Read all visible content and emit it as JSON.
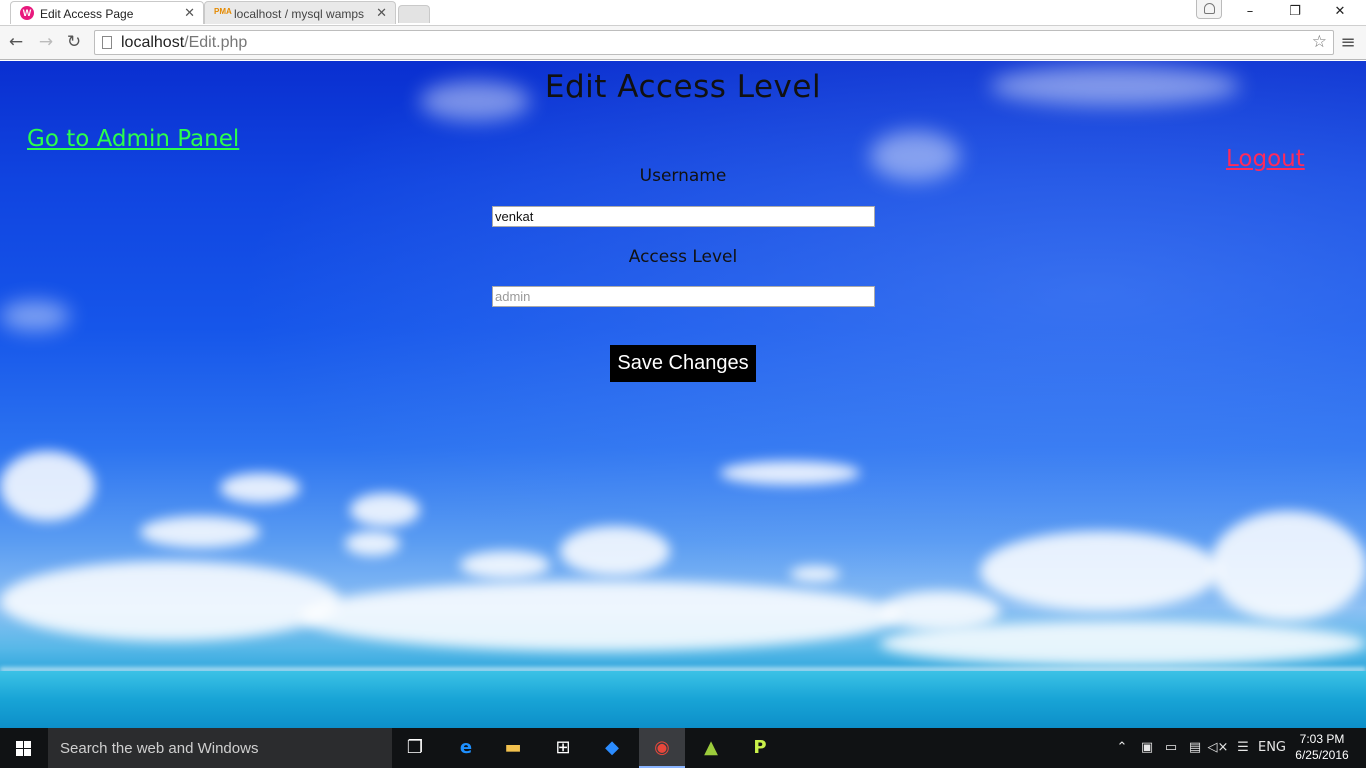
{
  "browser": {
    "tabs": [
      {
        "title": "Edit Access Page",
        "active": true,
        "favicon": "W"
      },
      {
        "title": "localhost / mysql wampse",
        "active": false,
        "favicon": "PMA"
      }
    ],
    "url_host": "localhost",
    "url_path": "/Edit.php",
    "window_controls": {
      "minimize": "–",
      "restore": "❐",
      "close": "✕"
    }
  },
  "page": {
    "heading": "Edit Access Level",
    "admin_link": "Go to Admin Panel",
    "logout_link": "Logout",
    "username_label": "Username",
    "username_value": "venkat",
    "access_level_label": "Access Level",
    "access_level_placeholder": "admin",
    "save_button": "Save Changes"
  },
  "taskbar": {
    "search_placeholder": "Search the web and Windows",
    "language": "ENG",
    "time": "7:03 PM",
    "date": "6/25/2016",
    "apps": [
      "task-view-icon",
      "edge-icon",
      "file-explorer-icon",
      "store-icon",
      "dropbox-icon",
      "chrome-icon",
      "android-studio-icon",
      "phpstorm-icon"
    ]
  },
  "colors": {
    "admin_link": "#2cff4a",
    "logout_link": "#ff2a5a",
    "save_button_bg": "#000000",
    "sky_top": "#0a2fd0"
  }
}
